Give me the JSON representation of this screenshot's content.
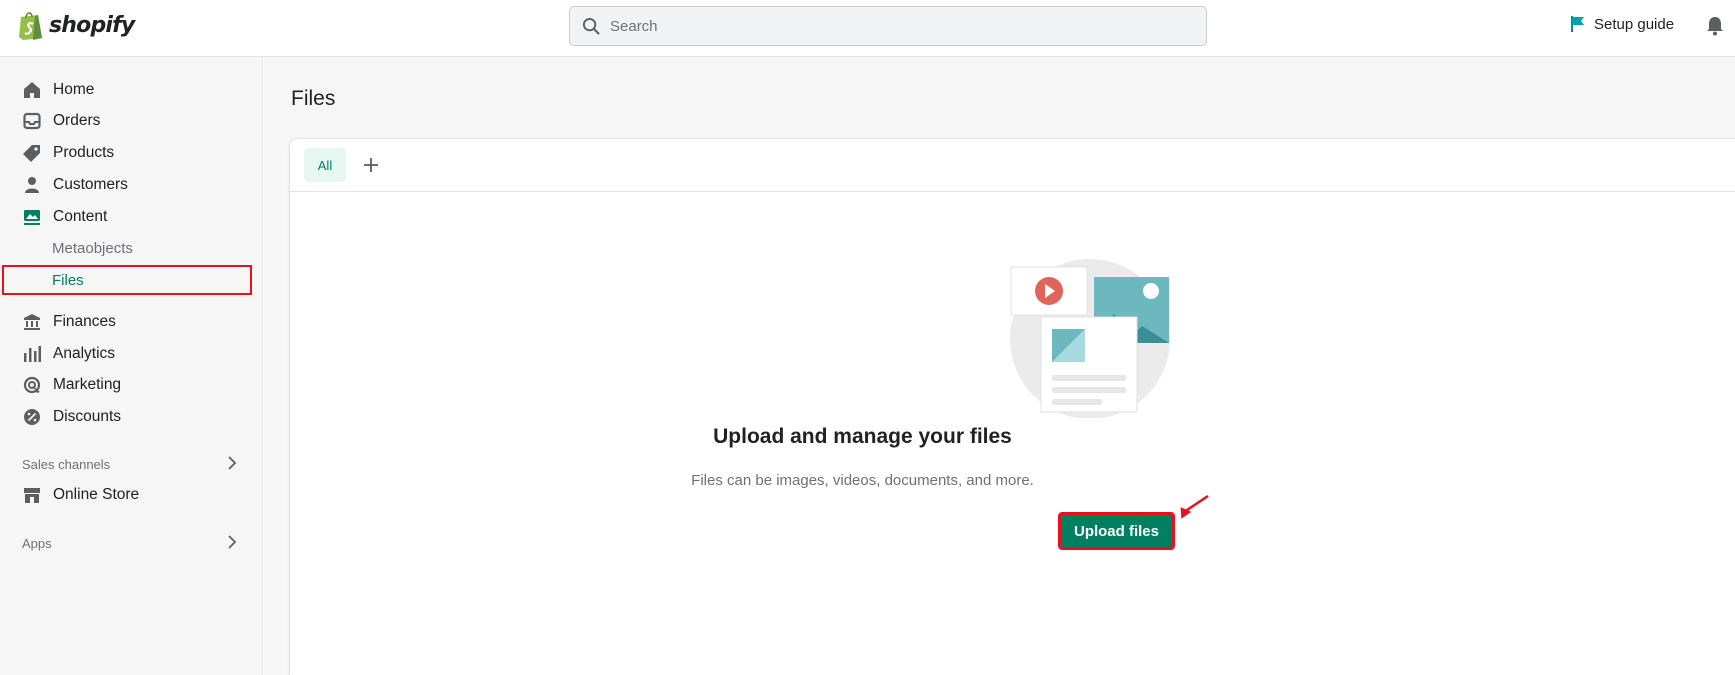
{
  "topbar": {
    "brand": "shopify",
    "search_placeholder": "Search",
    "setup_guide": "Setup guide"
  },
  "sidebar": {
    "items": [
      {
        "label": "Home",
        "icon": "home-icon"
      },
      {
        "label": "Orders",
        "icon": "inbox-icon"
      },
      {
        "label": "Products",
        "icon": "tag-icon"
      },
      {
        "label": "Customers",
        "icon": "person-icon"
      },
      {
        "label": "Content",
        "icon": "content-icon"
      }
    ],
    "content_sub": [
      {
        "label": "Metaobjects"
      },
      {
        "label": "Files"
      }
    ],
    "items2": [
      {
        "label": "Finances",
        "icon": "bank-icon"
      },
      {
        "label": "Analytics",
        "icon": "analytics-icon"
      },
      {
        "label": "Marketing",
        "icon": "target-icon"
      },
      {
        "label": "Discounts",
        "icon": "discount-icon"
      }
    ],
    "sales_channels_label": "Sales channels",
    "online_store": "Online Store",
    "apps_label": "Apps"
  },
  "main": {
    "page_title": "Files",
    "tabs": [
      {
        "label": "All"
      }
    ],
    "empty_state": {
      "title": "Upload and manage your files",
      "description": "Files can be images, videos, documents, and more.",
      "button": "Upload files"
    }
  },
  "colors": {
    "accent": "#008060",
    "highlight": "#e8101b"
  }
}
